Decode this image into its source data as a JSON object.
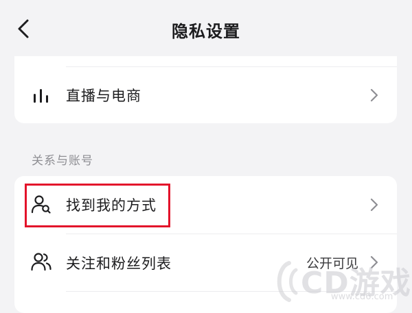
{
  "header": {
    "title": "隐私设置"
  },
  "card1": {
    "rows": [
      {
        "label": "直播与电商",
        "icon": "bar-chart-icon"
      }
    ]
  },
  "section": {
    "label": "关系与账号"
  },
  "card2": {
    "rows": [
      {
        "label": "找到我的方式",
        "icon": "person-search-icon"
      },
      {
        "label": "关注和粉丝列表",
        "value": "公开可见",
        "icon": "people-icon"
      }
    ]
  },
  "highlight_color": "#e3122a",
  "watermark": {
    "text": "CD游戏",
    "url": "www.cd6.com"
  }
}
